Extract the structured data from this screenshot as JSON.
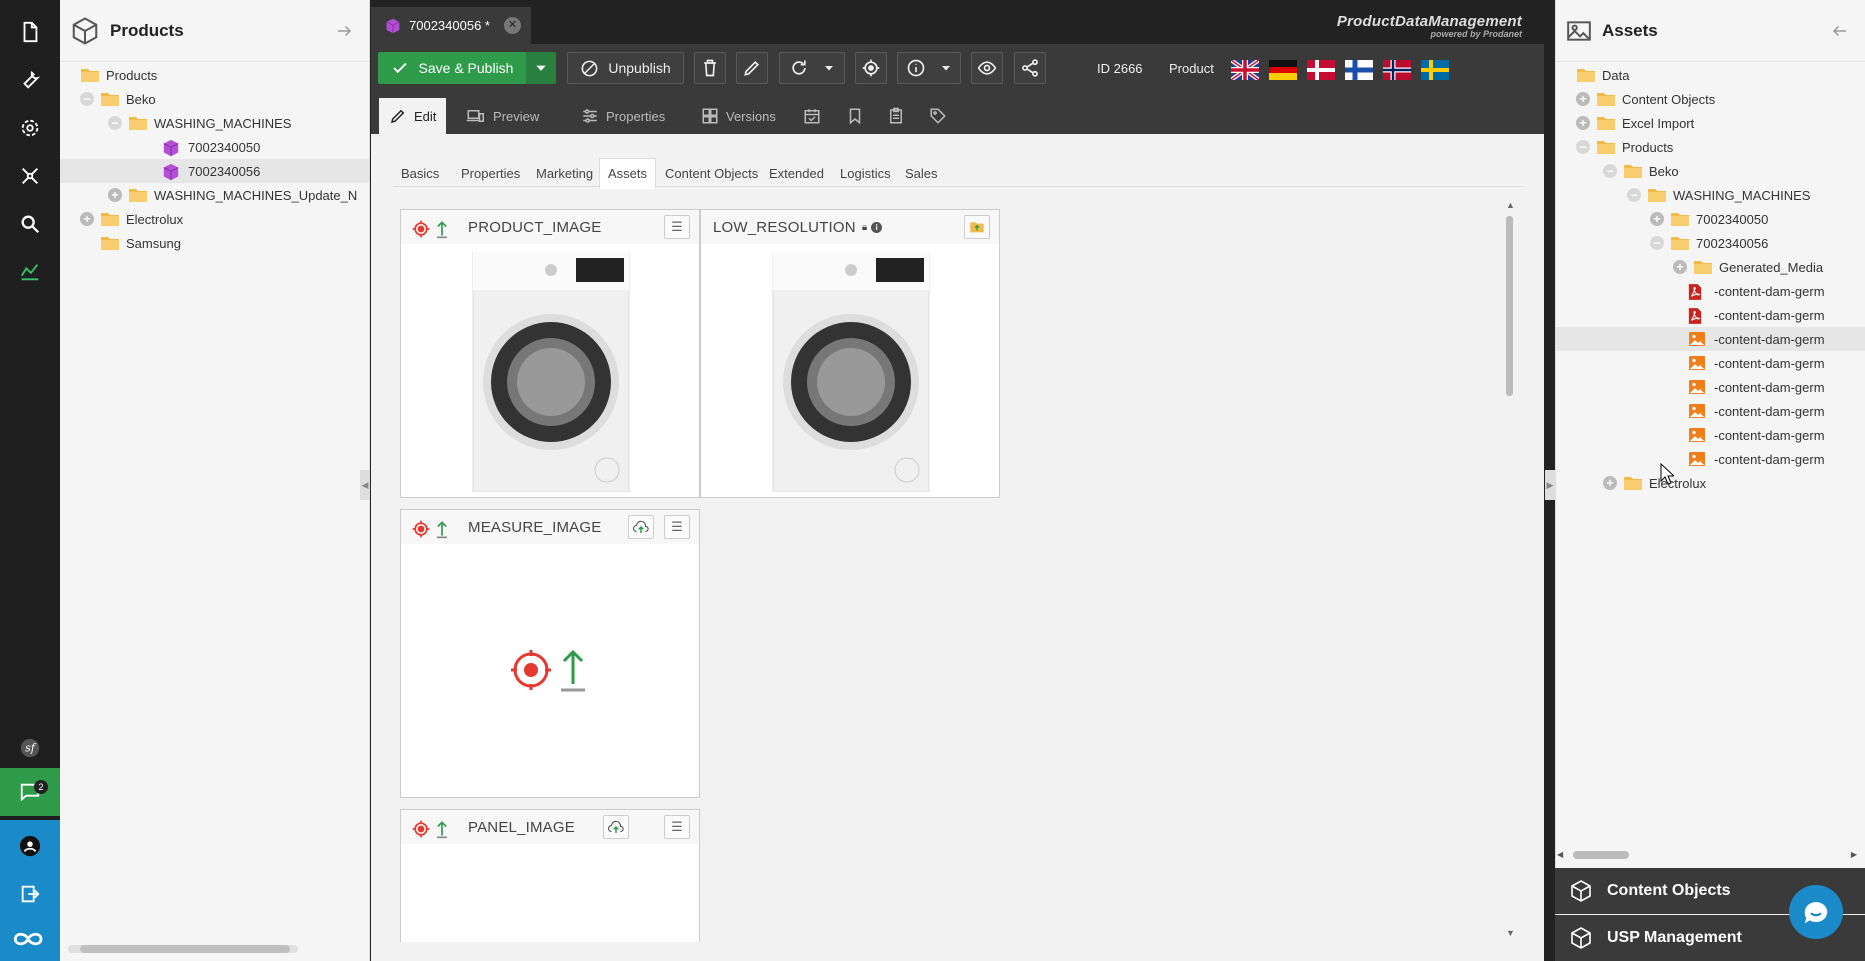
{
  "nav": {
    "chat_badge": "2"
  },
  "products_panel": {
    "title": "Products",
    "tree": [
      {
        "label": "Products",
        "type": "folder",
        "toggle": "none"
      },
      {
        "label": "Beko",
        "type": "folder",
        "toggle": "minus"
      },
      {
        "label": "WASHING_MACHINES",
        "type": "folder",
        "toggle": "minus"
      },
      {
        "label": "7002340050",
        "type": "object",
        "toggle": "none"
      },
      {
        "label": "7002340056",
        "type": "object",
        "toggle": "none",
        "selected": true
      },
      {
        "label": "WASHING_MACHINES_Update_N",
        "type": "folder",
        "toggle": "plus"
      },
      {
        "label": "Electrolux",
        "type": "folder",
        "toggle": "plus"
      },
      {
        "label": "Samsung",
        "type": "folder",
        "toggle": "none"
      }
    ]
  },
  "editor": {
    "tab_label": "7002340056 *",
    "brand_name": "ProductDataManagement",
    "brand_sub": "powered by Prodanet",
    "save_label": "Save & Publish",
    "unpublish_label": "Unpublish",
    "id_label": "ID 2666",
    "class_label": "Product",
    "flags": [
      "uk",
      "de",
      "dk",
      "fi",
      "no",
      "se"
    ],
    "subtabs": [
      "Edit",
      "Preview",
      "Properties",
      "Versions"
    ],
    "inner_tabs": [
      "Basics",
      "Properties",
      "Marketing",
      "Assets",
      "Content Objects",
      "Extended",
      "Logistics",
      "Sales"
    ],
    "active_inner_tab": "Assets",
    "cards": {
      "product_image": "PRODUCT_IMAGE",
      "low_resolution": "LOW_RESOLUTION",
      "measure_image": "MEASURE_IMAGE",
      "panel_image": "PANEL_IMAGE"
    }
  },
  "assets_panel": {
    "title": "Assets",
    "tree": [
      {
        "label": "Data",
        "type": "folder",
        "toggle": "none"
      },
      {
        "label": "Content Objects",
        "type": "folder",
        "toggle": "plus"
      },
      {
        "label": "Excel Import",
        "type": "folder",
        "toggle": "plus"
      },
      {
        "label": "Products",
        "type": "folder",
        "toggle": "minus"
      },
      {
        "label": "Beko",
        "type": "folder",
        "toggle": "minus"
      },
      {
        "label": "WASHING_MACHINES",
        "type": "folder",
        "toggle": "minus"
      },
      {
        "label": "7002340050",
        "type": "folder",
        "toggle": "plus"
      },
      {
        "label": "7002340056",
        "type": "folder",
        "toggle": "minus"
      },
      {
        "label": "Generated_Media",
        "type": "folder",
        "toggle": "plus"
      },
      {
        "label": "-content-dam-germ",
        "type": "pdf",
        "toggle": "none"
      },
      {
        "label": "-content-dam-germ",
        "type": "pdf",
        "toggle": "none"
      },
      {
        "label": "-content-dam-germ",
        "type": "image",
        "toggle": "none",
        "selected": true
      },
      {
        "label": "-content-dam-germ",
        "type": "image",
        "toggle": "none"
      },
      {
        "label": "-content-dam-germ",
        "type": "image",
        "toggle": "none"
      },
      {
        "label": "-content-dam-germ",
        "type": "image",
        "toggle": "none"
      },
      {
        "label": "-content-dam-germ",
        "type": "image",
        "toggle": "none"
      },
      {
        "label": "-content-dam-germ",
        "type": "image",
        "toggle": "none"
      },
      {
        "label": "Electrolux",
        "type": "folder",
        "toggle": "plus"
      }
    ],
    "bottom_panels": [
      "Content Objects",
      "USP Management"
    ]
  },
  "colors": {
    "accent_green": "#2e9b4a",
    "accent_blue": "#1a8ac8",
    "target_red": "#e5382f",
    "folder": "#f2b94b"
  }
}
